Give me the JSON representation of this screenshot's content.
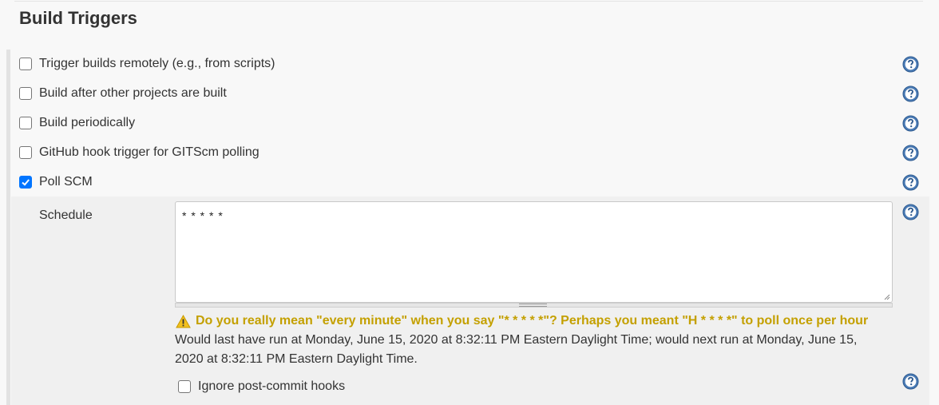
{
  "section": {
    "title": "Build Triggers"
  },
  "triggers": [
    {
      "label": "Trigger builds remotely (e.g., from scripts)",
      "checked": false
    },
    {
      "label": "Build after other projects are built",
      "checked": false
    },
    {
      "label": "Build periodically",
      "checked": false
    },
    {
      "label": "GitHub hook trigger for GITScm polling",
      "checked": false
    },
    {
      "label": "Poll SCM",
      "checked": true
    }
  ],
  "poll_scm": {
    "schedule_label": "Schedule",
    "schedule_value": "* * * * *",
    "warning": "Do you really mean \"every minute\" when you say \"* * * * *\"? Perhaps you meant \"H * * * *\" to poll once per hour",
    "info": "Would last have run at Monday, June 15, 2020 at 8:32:11 PM Eastern Daylight Time; would next run at Monday, June 15, 2020 at 8:32:11 PM Eastern Daylight Time.",
    "ignore_hooks": {
      "label": "Ignore post-commit hooks",
      "checked": false
    }
  },
  "icons": {
    "help": "help-icon",
    "warning": "warning-icon"
  },
  "colors": {
    "accent": "#0075ff",
    "warning": "#c4a000",
    "help": "#4a7bb5"
  }
}
